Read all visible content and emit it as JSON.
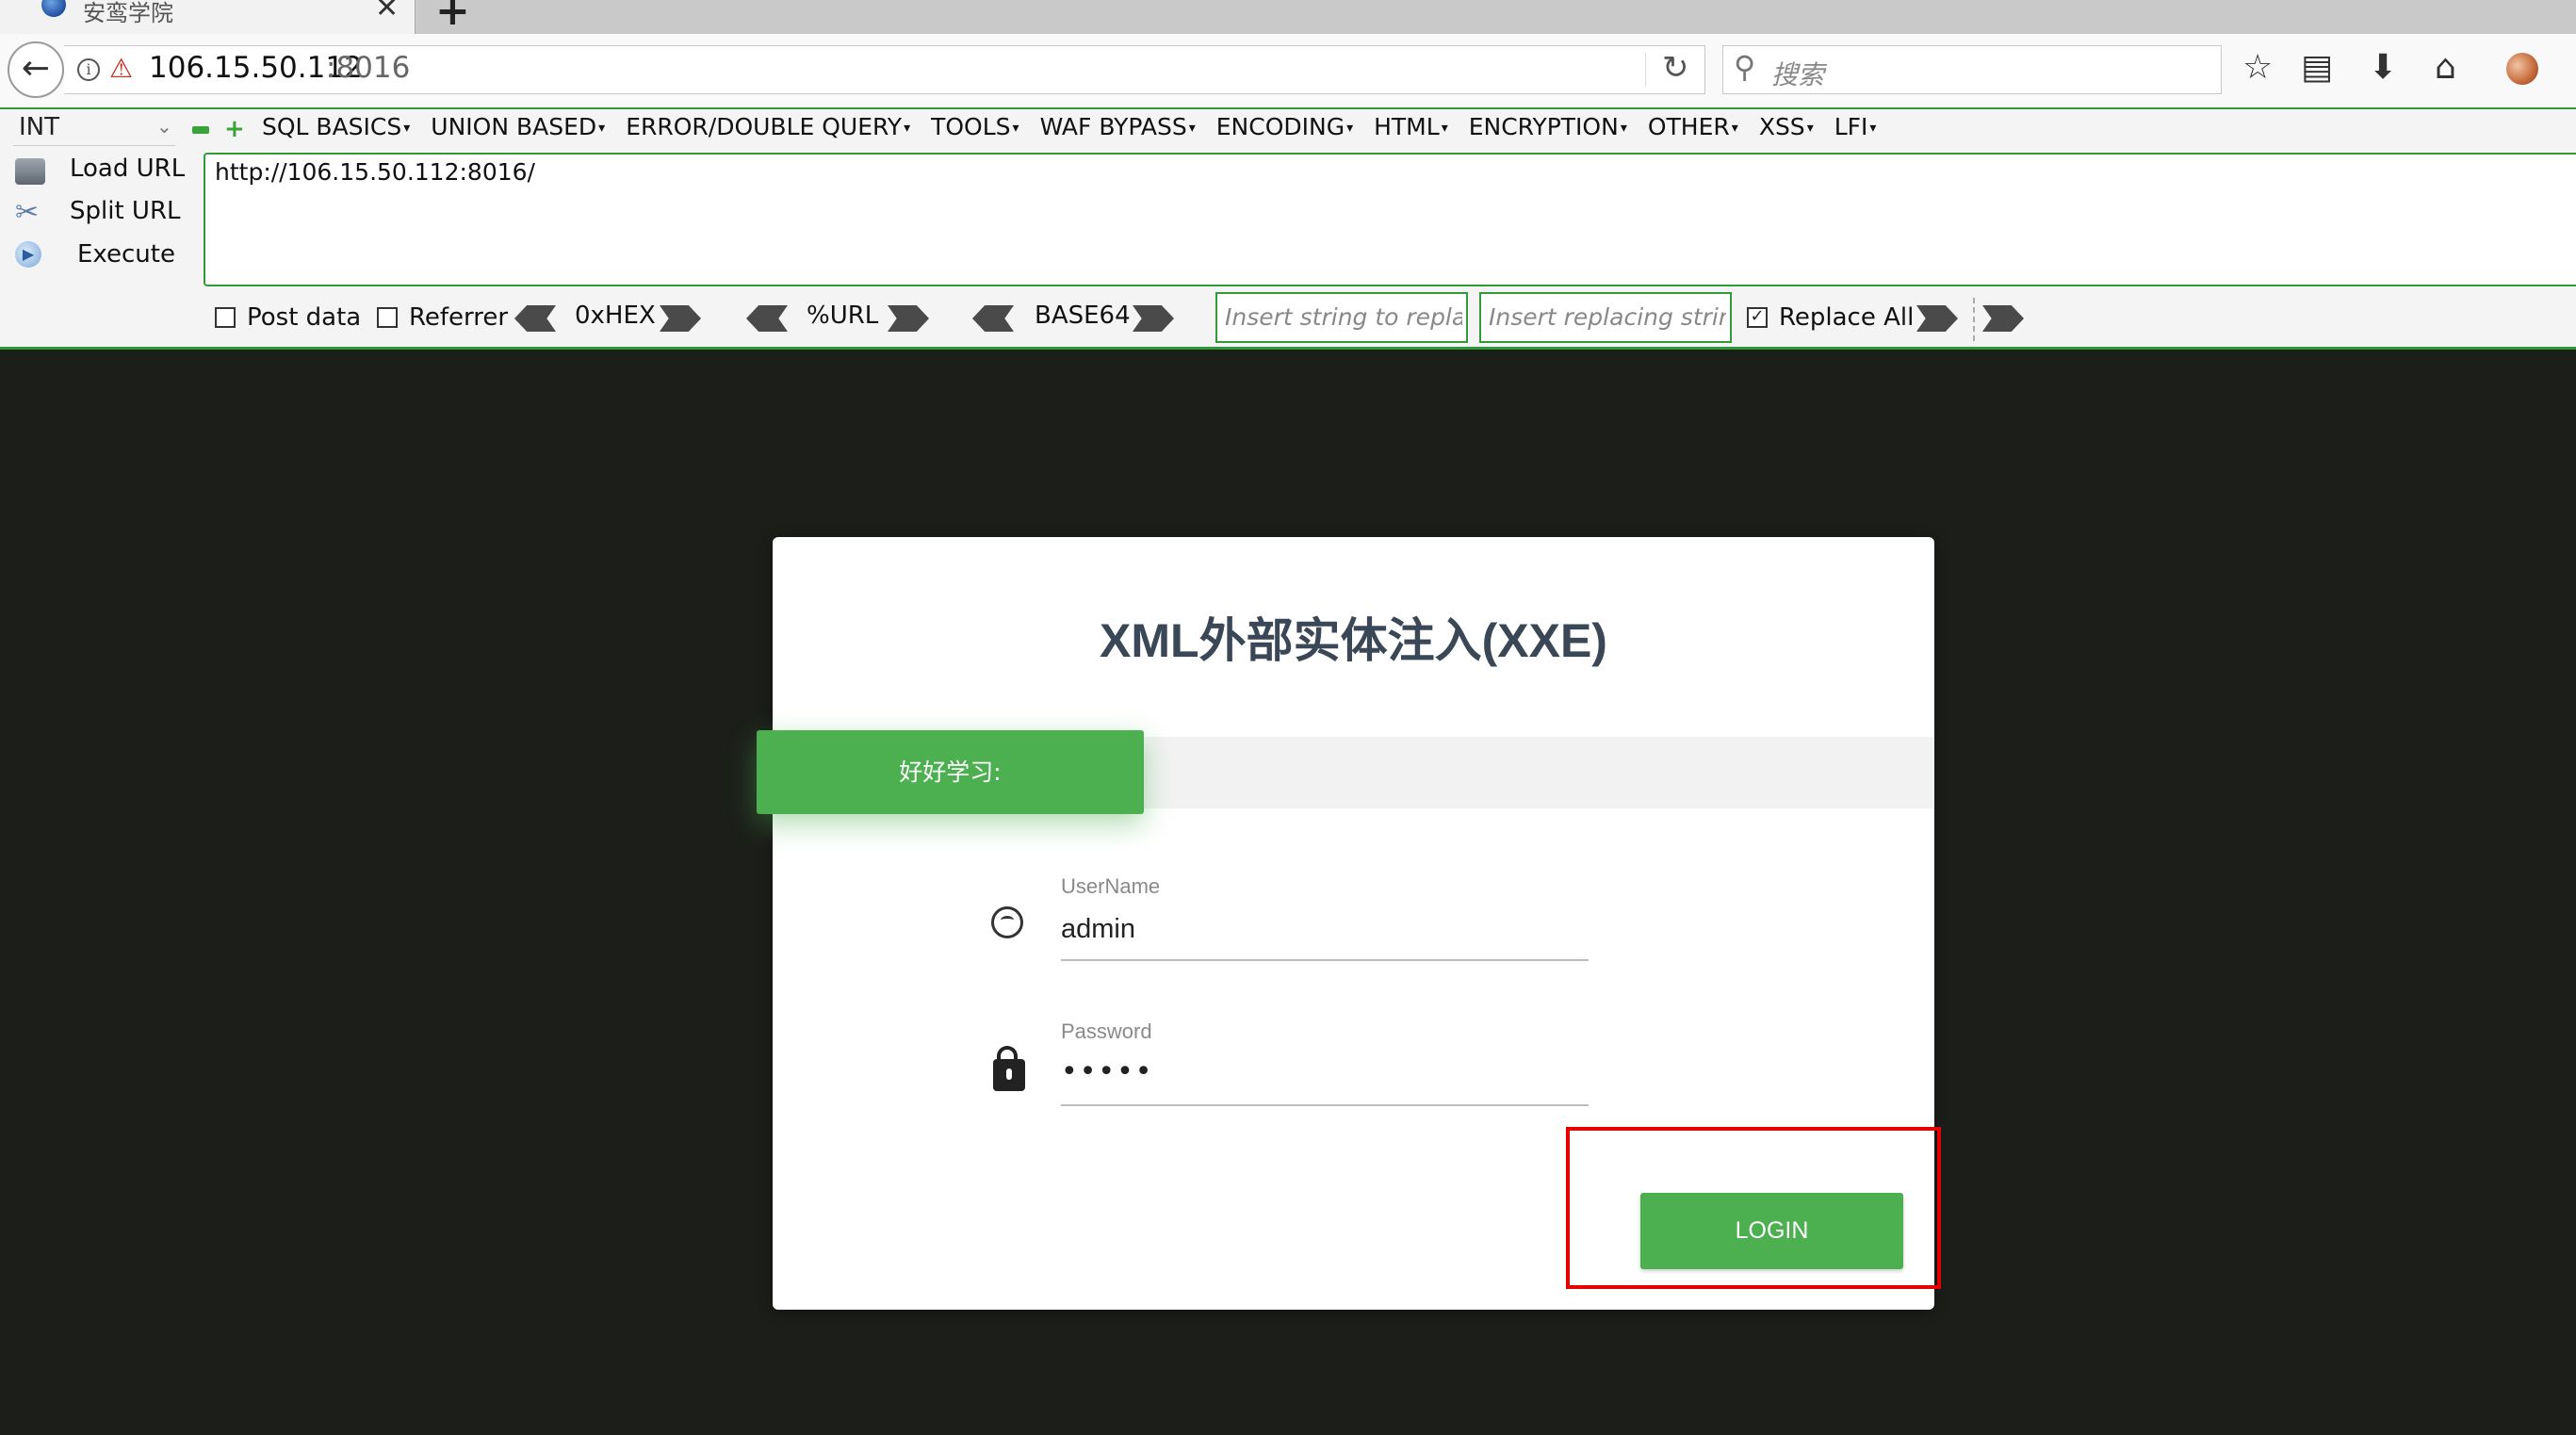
{
  "browser": {
    "tab_title": "安鸾学院",
    "url_host": "106.15.50.112",
    "url_port": ":8016",
    "search_placeholder": "搜索",
    "icons": [
      "back-icon",
      "info-icon",
      "insecure-icon",
      "reload-icon",
      "search-icon",
      "bookmark-star-icon",
      "library-icon",
      "download-icon",
      "home-icon",
      "extension-icon"
    ]
  },
  "hackbar": {
    "int_select": "INT",
    "menu": [
      "SQL BASICS",
      "UNION BASED",
      "ERROR/DOUBLE QUERY",
      "TOOLS",
      "WAF BYPASS",
      "ENCODING",
      "HTML",
      "ENCRYPTION",
      "OTHER",
      "XSS",
      "LFI"
    ],
    "load_url": "Load URL",
    "split_url": "Split URL",
    "execute": "Execute",
    "url_text": "http://106.15.50.112:8016/",
    "post_data": "Post data",
    "referrer": "Referrer",
    "hex": "0xHEX",
    "urlenc": "%URL",
    "base64": "BASE64",
    "find_placeholder": "Insert string to replace",
    "replace_placeholder": "Insert replacing string",
    "replace_all": "Replace All",
    "replace_all_checked": true
  },
  "page": {
    "title": "XML外部实体注入(XXE)",
    "tag": "好好学习:",
    "username_label": "UserName",
    "username_value": "admin",
    "password_label": "Password",
    "password_value": "•••••",
    "login_button": "LOGIN",
    "accent_color": "#4caf50",
    "highlight_color": "#e50000"
  }
}
